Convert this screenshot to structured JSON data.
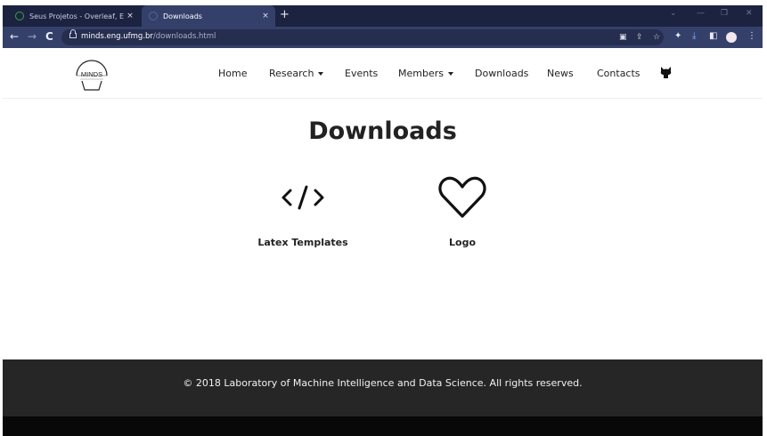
{
  "browser": {
    "tabs": [
      {
        "title": "Seus Projetos - Overleaf, Editor L",
        "active": false
      },
      {
        "title": "Downloads",
        "active": true
      }
    ],
    "new_tab": "+",
    "tab_close": "×",
    "url_host": "minds.eng.ufmg.br",
    "url_path": "/downloads.html",
    "icons": [
      "back-icon",
      "forward-icon",
      "reload-icon",
      "lock-icon",
      "translate-icon",
      "share-icon",
      "star-icon",
      "extensions-icon",
      "download-icon",
      "sidepanel-icon",
      "profile-icon",
      "menu-icon"
    ]
  },
  "site": {
    "logo_text": "MINDS",
    "nav": {
      "home": "Home",
      "research": "Research",
      "events": "Events",
      "members": "Members",
      "downloads": "Downloads",
      "news": "News",
      "contacts": "Contacts"
    },
    "heading": "Downloads",
    "items": [
      {
        "label": "Latex Templates",
        "icon": "code-icon"
      },
      {
        "label": "Logo",
        "icon": "heart-icon"
      }
    ],
    "footer": "© 2018 Laboratory of Machine Intelligence and Data Science. All rights reserved."
  },
  "colors": {
    "tabstrip": "#1c2340",
    "toolbar": "#35406a",
    "footer": "#262626",
    "text": "#222222"
  }
}
